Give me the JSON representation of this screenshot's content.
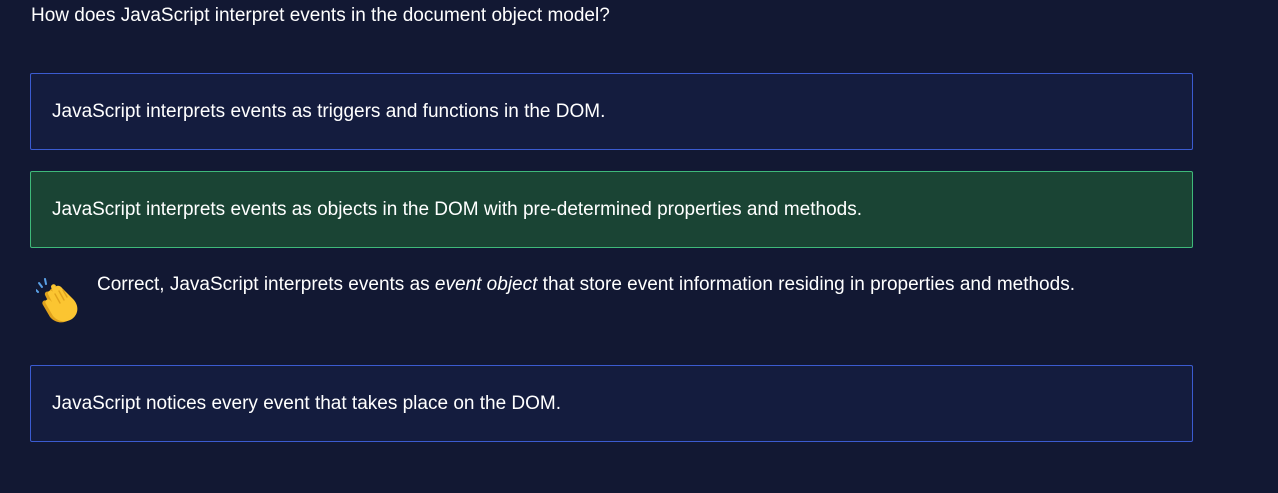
{
  "question": "How does JavaScript interpret events in the document object model?",
  "options": [
    {
      "label": "JavaScript interprets events as triggers and functions in the DOM.",
      "state": "default"
    },
    {
      "label": "JavaScript interprets events as objects in the DOM with pre-determined properties and methods.",
      "state": "correct"
    },
    {
      "label": "JavaScript notices every event that takes place on the DOM.",
      "state": "default"
    }
  ],
  "feedback": {
    "icon": "clapping-hands-icon",
    "prefix": "Correct, JavaScript interprets events as ",
    "emphasis": "event object",
    "suffix": " that store event information residing in properties and methods."
  },
  "colors": {
    "background": "#121833",
    "option_bg": "#141c3e",
    "option_border": "#3b5bd0",
    "correct_bg": "#1a4434",
    "correct_border": "#3fb97a"
  }
}
